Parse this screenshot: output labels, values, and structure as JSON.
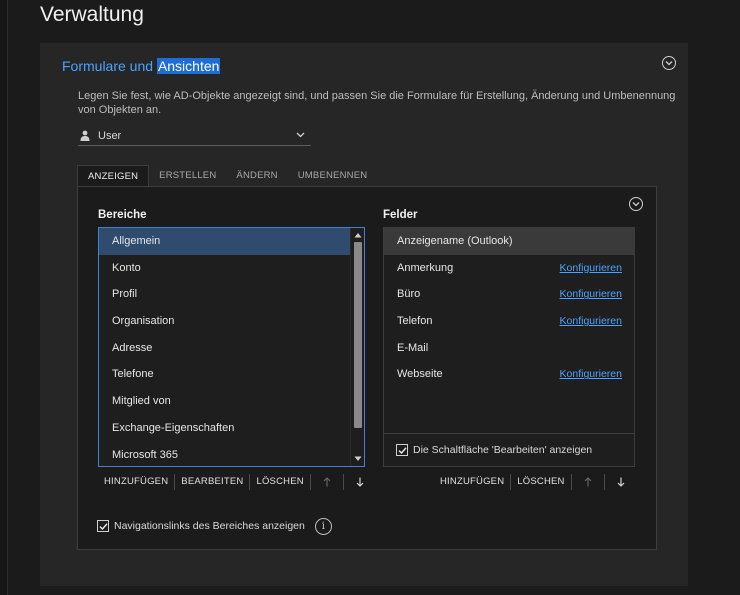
{
  "page": {
    "title": "Verwaltung"
  },
  "panel": {
    "header_plain": "Formulare und ",
    "header_highlight": "Ansichten",
    "description": "Legen Sie fest, wie AD-Objekte angezeigt sind, und passen Sie die Formulare für Erstellung, Änderung und Umbenennung von Objekten an.",
    "object_select": {
      "icon": "user-icon",
      "value": "User"
    }
  },
  "tabs": [
    {
      "label": "ANZEIGEN",
      "active": true
    },
    {
      "label": "ERSTELLEN",
      "active": false
    },
    {
      "label": "ÄNDERN",
      "active": false
    },
    {
      "label": "UMBENENNEN",
      "active": false
    }
  ],
  "areas": {
    "title": "Bereiche",
    "items": [
      "Allgemein",
      "Konto",
      "Profil",
      "Organisation",
      "Adresse",
      "Telefone",
      "Mitglied von",
      "Exchange-Eigenschaften",
      "Microsoft 365"
    ],
    "selected_index": 0,
    "toolbar": {
      "add": "HINZUFÜGEN",
      "edit": "BEARBEITEN",
      "delete": "LÖSCHEN"
    }
  },
  "fields": {
    "title": "Felder",
    "rows": [
      {
        "name": "Anzeigename (Outlook)",
        "link": ""
      },
      {
        "name": "Anmerkung",
        "link": "Konfigurieren"
      },
      {
        "name": "Büro",
        "link": "Konfigurieren"
      },
      {
        "name": "Telefon",
        "link": "Konfigurieren"
      },
      {
        "name": "E-Mail",
        "link": ""
      },
      {
        "name": "Webseite",
        "link": "Konfigurieren"
      }
    ],
    "edit_button_checkbox": {
      "label": "Die Schaltfläche 'Bearbeiten' anzeigen",
      "checked": true
    },
    "toolbar": {
      "add": "HINZUFÜGEN",
      "delete": "LÖSCHEN"
    }
  },
  "nav_links_checkbox": {
    "label": "Navigationslinks des Bereiches anzeigen",
    "checked": true
  },
  "colors": {
    "accent": "#4aa3ff",
    "selection": "#2f4c6e",
    "background": "#1b1b1b",
    "panel": "#262626"
  }
}
